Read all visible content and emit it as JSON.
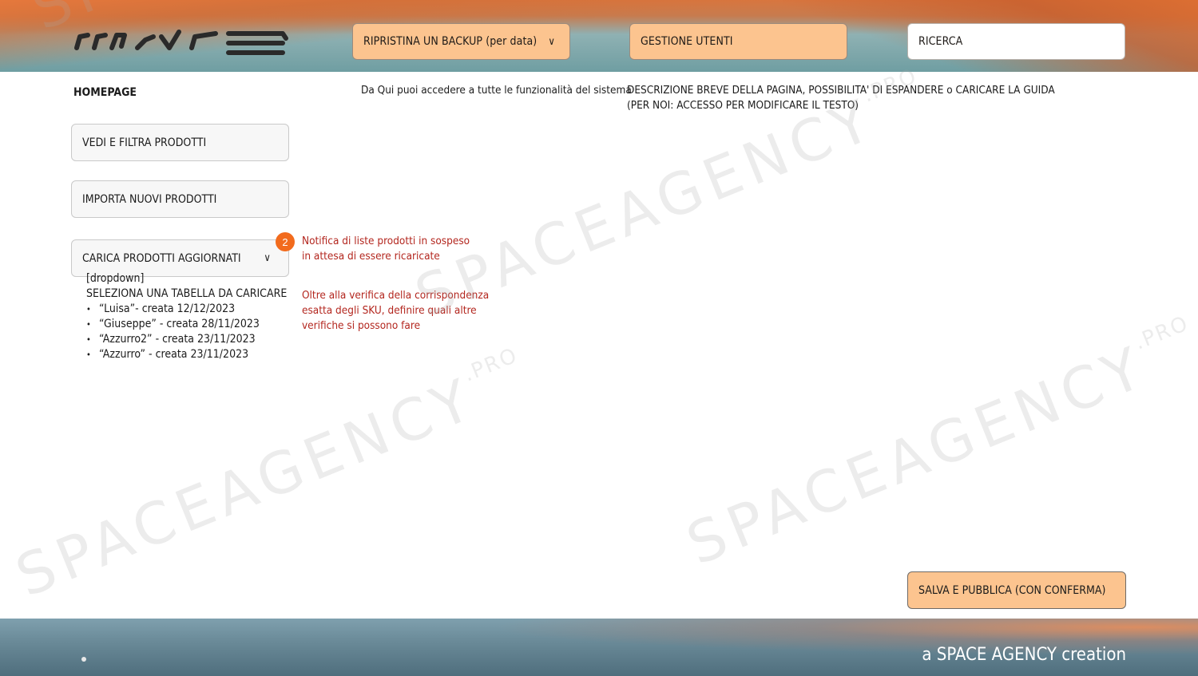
{
  "header": {
    "backup_button": "RIPRISTINA UN BACKUP (per data)",
    "users_button": "GESTIONE UTENTI",
    "search_placeholder": "RICERCA"
  },
  "main": {
    "title": "HOMEPAGE",
    "intro": "Da Qui puoi accedere a tutte le funzionalità del sistema",
    "description_line1": "DESCRIZIONE BREVE DELLA PAGINA, POSSIBILITA' DI ESPANDERE o CARICARE LA GUIDA",
    "description_line2": "(PER NOI: ACCESSO PER MODIFICARE IL TESTO)"
  },
  "sidebar": {
    "items": [
      {
        "label": "VEDI E FILTRA PRODOTTI"
      },
      {
        "label": "IMPORTA NUOVI PRODOTTI"
      },
      {
        "label": "CARICA PRODOTTI AGGIORNATI"
      }
    ],
    "badge_count": "2"
  },
  "dropdown": {
    "tag": "[dropdown]",
    "heading": "SELEZIONA UNA TABELLA DA CARICARE",
    "items": [
      "“Luisa”- creata 12/12/2023",
      "“Giuseppe” - creata 28/11/2023",
      "“Azzurro2” - creata 23/11/2023",
      "“Azzurro” - creata 23/11/2023"
    ]
  },
  "notes": {
    "pending_line1": "Notifica di liste prodotti in sospeso",
    "pending_line2": "in attesa di essere ricaricate",
    "verify_line1": "Oltre alla verifica della corrispondenza",
    "verify_line2": "esatta degli SKU, definire quali altre",
    "verify_line3": "verifiche si possono fare"
  },
  "actions": {
    "save_button": "SALVA E PUBBLICA (CON CONFERMA)"
  },
  "watermark": {
    "text": "SPACEAGENCY",
    "suffix": ".PRO"
  },
  "footer": {
    "credit": "a SPACE AGENCY creation"
  },
  "colors": {
    "accent_peach": "#fcc48f",
    "note_red": "#b3261e",
    "badge_orange": "#f26b1d"
  }
}
